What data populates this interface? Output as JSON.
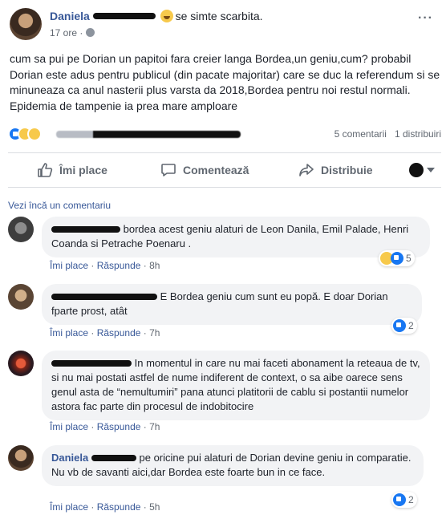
{
  "post": {
    "author": "Daniela",
    "feeling": "se simte scarbita.",
    "time": "17 ore",
    "text": "cum sa pui pe Dorian un papitoi fara creier langa Bordea,un geniu,cum? probabil Dorian este adus pentru publicul (din pacate majoritar) care se duc la referendum si se minuneaza ca anul nasterii plus varsta da 2018,Bordea pentru noi restul normali. Epidemia de tampenie ia prea mare amploare",
    "comments_count": "5 comentarii",
    "shares_count": "1 distribuiri"
  },
  "actions": {
    "like": "Îmi place",
    "comment": "Comentează",
    "share": "Distribuie"
  },
  "view_more": "Vezi încă un comentariu",
  "comments": [
    {
      "text": "bordea acest geniu alaturi de Leon Danila, Emil Palade, Henri Coanda si Petrache Poenaru .",
      "like": "Îmi place",
      "reply": "Răspunde",
      "time": "8h",
      "reactions": "5"
    },
    {
      "text": "E Bordea geniu cum sunt eu popă. E doar Dorian fparte prost, atât",
      "like": "Îmi place",
      "reply": "Răspunde",
      "time": "7h",
      "reactions": "2"
    },
    {
      "text": "In momentul in care nu mai faceti abonament la reteaua de tv, si nu mai postati astfel de nume indiferent de context, o sa aibe oarece sens genul asta de “nemultumiri” pana atunci platitorii de cablu si postantii numelor astora fac parte din procesul de indobitocire",
      "like": "Îmi place",
      "reply": "Răspunde",
      "time": "7h",
      "reactions": ""
    },
    {
      "author": "Daniela",
      "text": "pe oricine pui alaturi de Dorian devine geniu in comparatie. Nu vb de savanti aici,dar Bordea este foarte bun in ce face.",
      "like": "Îmi place",
      "reply": "Răspunde",
      "time": "5h",
      "reactions": "2"
    }
  ],
  "separator": " · ",
  "colors": {
    "link": "#385898",
    "secondary": "#606770",
    "bubble": "#f2f3f5",
    "like_blue": "#1877f2"
  }
}
